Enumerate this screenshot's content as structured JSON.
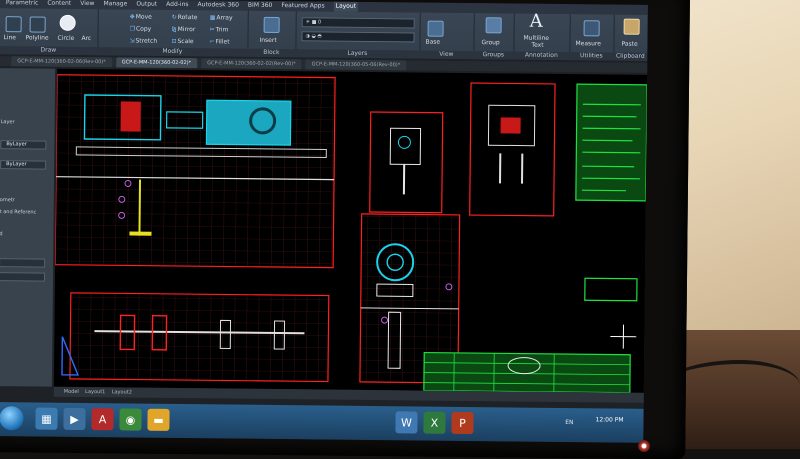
{
  "ribbon_tabs": [
    "Parametric",
    "Content",
    "View",
    "Manage",
    "Output",
    "Add-ins",
    "Autodesk 360",
    "BIM 360",
    "Featured Apps",
    "Layout"
  ],
  "active_tab_index": 9,
  "groups": {
    "draw": "Draw",
    "modify": "Modify",
    "layers": "Layers",
    "view": "View",
    "groups": "Groups",
    "annotation": "Annotation",
    "utilities": "Utilities",
    "clipboard": "Clipboard"
  },
  "draw_tools": {
    "line": "Line",
    "polyline": "Polyline",
    "circle": "Circle",
    "arc": "Arc"
  },
  "modify_tools": {
    "move": "Move",
    "rotate": "Rotate",
    "array": "Array",
    "copy": "Copy",
    "mirror": "Mirror",
    "trim": "Trim",
    "stretch": "Stretch",
    "scale": "Scale",
    "fillet": "Fillet"
  },
  "block_tools": {
    "insert": "Insert",
    "block": "Block"
  },
  "other_tools": {
    "base": "Base",
    "group": "Group",
    "text_glyph": "A",
    "text_line1": "Multiline",
    "text_line2": "Text",
    "measure": "Measure",
    "paste": "Paste"
  },
  "document_tabs": [
    "GCP-E-MM-120(360-02-06(Rev-00)*",
    "GCP-E-MM-120(360-02-02)*",
    "GCP-E-MM-120(360-02-02(Rev-00)*",
    "GCP-E-MM-120(360-05-06(Rev-00)*"
  ],
  "active_doc_index": 1,
  "palette_labels": {
    "layer": "Layer",
    "bylayer1": "ByLayer",
    "bylayer2": "ByLayer",
    "geometry": "ometr",
    "and_reference": "t and Referenc",
    "d": "d"
  },
  "status_items": [
    "Layout1",
    "Layout2"
  ],
  "status_tab_1": "Model",
  "clock_time": "12:00 PM",
  "tray_lang": "EN",
  "colors": {
    "accent": "#ff2020",
    "cyan": "#19d4ea",
    "green": "#20e040",
    "magenta": "#c060e0",
    "yellow": "#e8e020"
  }
}
